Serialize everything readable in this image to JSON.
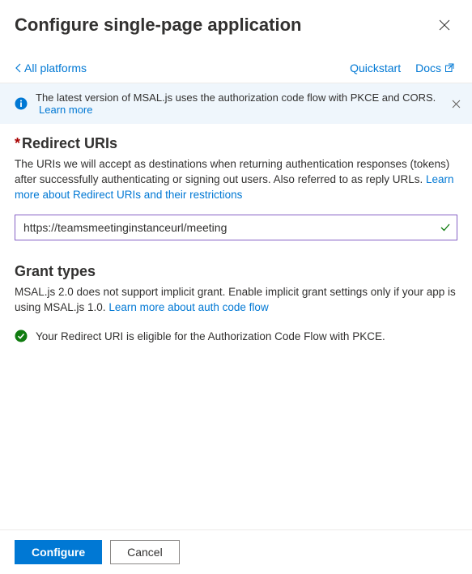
{
  "header": {
    "title": "Configure single-page application"
  },
  "nav": {
    "back_label": "All platforms",
    "quickstart": "Quickstart",
    "docs": "Docs"
  },
  "info": {
    "message": "The latest version of MSAL.js uses the authorization code flow with PKCE and CORS.",
    "learn_more": "Learn more"
  },
  "redirect": {
    "title": "Redirect URIs",
    "desc_a": "The URIs we will accept as destinations when returning authentication responses (tokens) after successfully authenticating or signing out users. Also referred to as reply URLs. ",
    "desc_link": "Learn more about Redirect URIs and their restrictions",
    "value": "https://teamsmeetinginstanceurl/meeting"
  },
  "grant": {
    "title": "Grant types",
    "desc_a": "MSAL.js 2.0 does not support implicit grant. Enable implicit grant settings only if your app is using MSAL.js 1.0. ",
    "desc_link": "Learn more about auth code flow",
    "status": "Your Redirect URI is eligible for the Authorization Code Flow with PKCE."
  },
  "footer": {
    "configure": "Configure",
    "cancel": "Cancel"
  }
}
